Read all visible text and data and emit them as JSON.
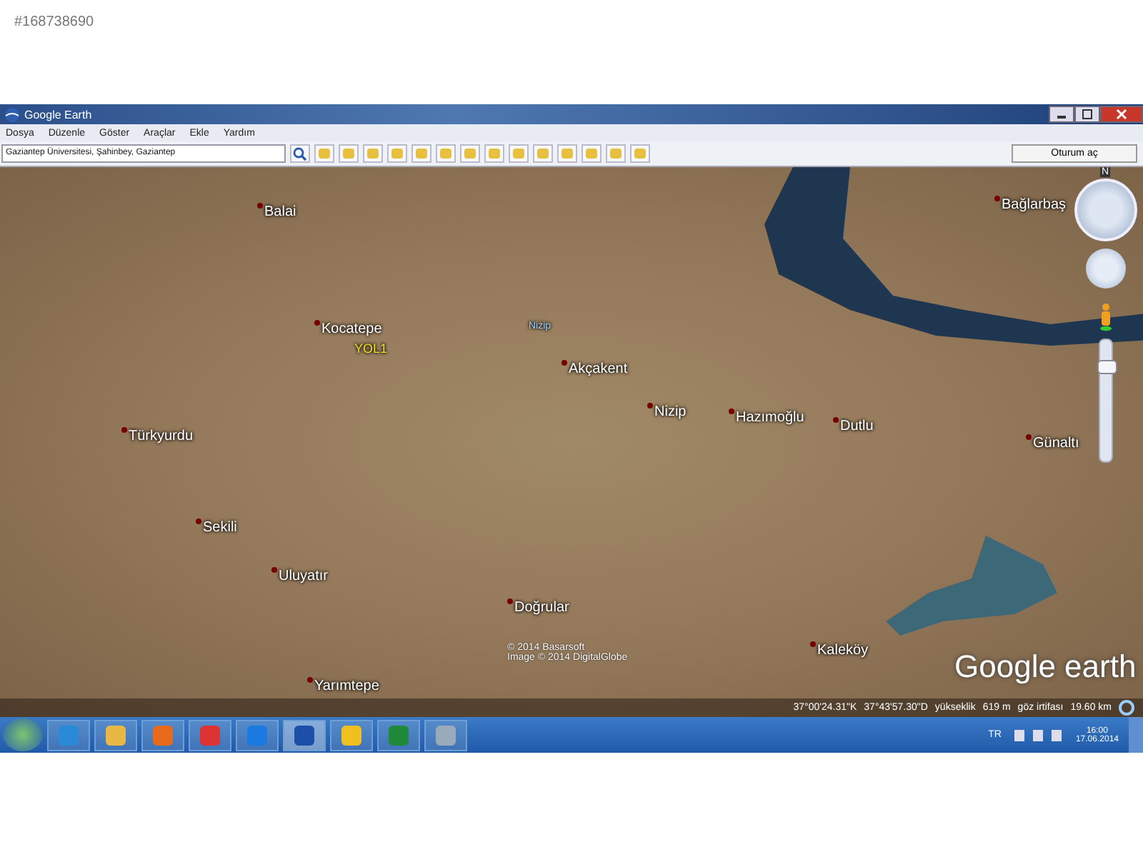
{
  "listing_id": "#168738690",
  "window": {
    "title": "Google Earth"
  },
  "menu": [
    "Dosya",
    "Düzenle",
    "Göster",
    "Araçlar",
    "Ekle",
    "Yardım"
  ],
  "search": {
    "value": "Gaziantep Üniversitesi, Şahinbey, Gaziantep"
  },
  "signin_button": "Oturum aç",
  "places": [
    {
      "name": "Balai",
      "kind": "place"
    },
    {
      "name": "Kocatepe",
      "kind": "place"
    },
    {
      "name": "YOL1",
      "kind": "road"
    },
    {
      "name": "Nizip",
      "kind": "river"
    },
    {
      "name": "Akçakent",
      "kind": "place"
    },
    {
      "name": "Nizip",
      "kind": "place"
    },
    {
      "name": "Hazımoğlu",
      "kind": "place"
    },
    {
      "name": "Dutlu",
      "kind": "place"
    },
    {
      "name": "Türkyurdu",
      "kind": "place"
    },
    {
      "name": "Sekili",
      "kind": "place"
    },
    {
      "name": "Uluyatır",
      "kind": "place"
    },
    {
      "name": "Doğrular",
      "kind": "place"
    },
    {
      "name": "Kaleköy",
      "kind": "place"
    },
    {
      "name": "Yarımtepe",
      "kind": "place"
    },
    {
      "name": "Bağlarbaş",
      "kind": "place"
    },
    {
      "name": "Günaltı",
      "kind": "place"
    }
  ],
  "compass_north": "N",
  "zoom": {
    "level": 0.82
  },
  "attribution": [
    "© 2014 Basarsoft",
    "Image © 2014 DigitalGlobe"
  ],
  "logo": "Google earth",
  "status_bar": {
    "latitude": "37°00'24.31\"K",
    "longitude": "37°43'57.30\"D",
    "elevation_label": "yükseklik",
    "elevation": "619 m",
    "eye_alt_label": "göz irtifası",
    "eye_alt": "19.60 km"
  },
  "taskbar": {
    "language": "TR",
    "time": "16:00",
    "date": "17.06.2014"
  }
}
